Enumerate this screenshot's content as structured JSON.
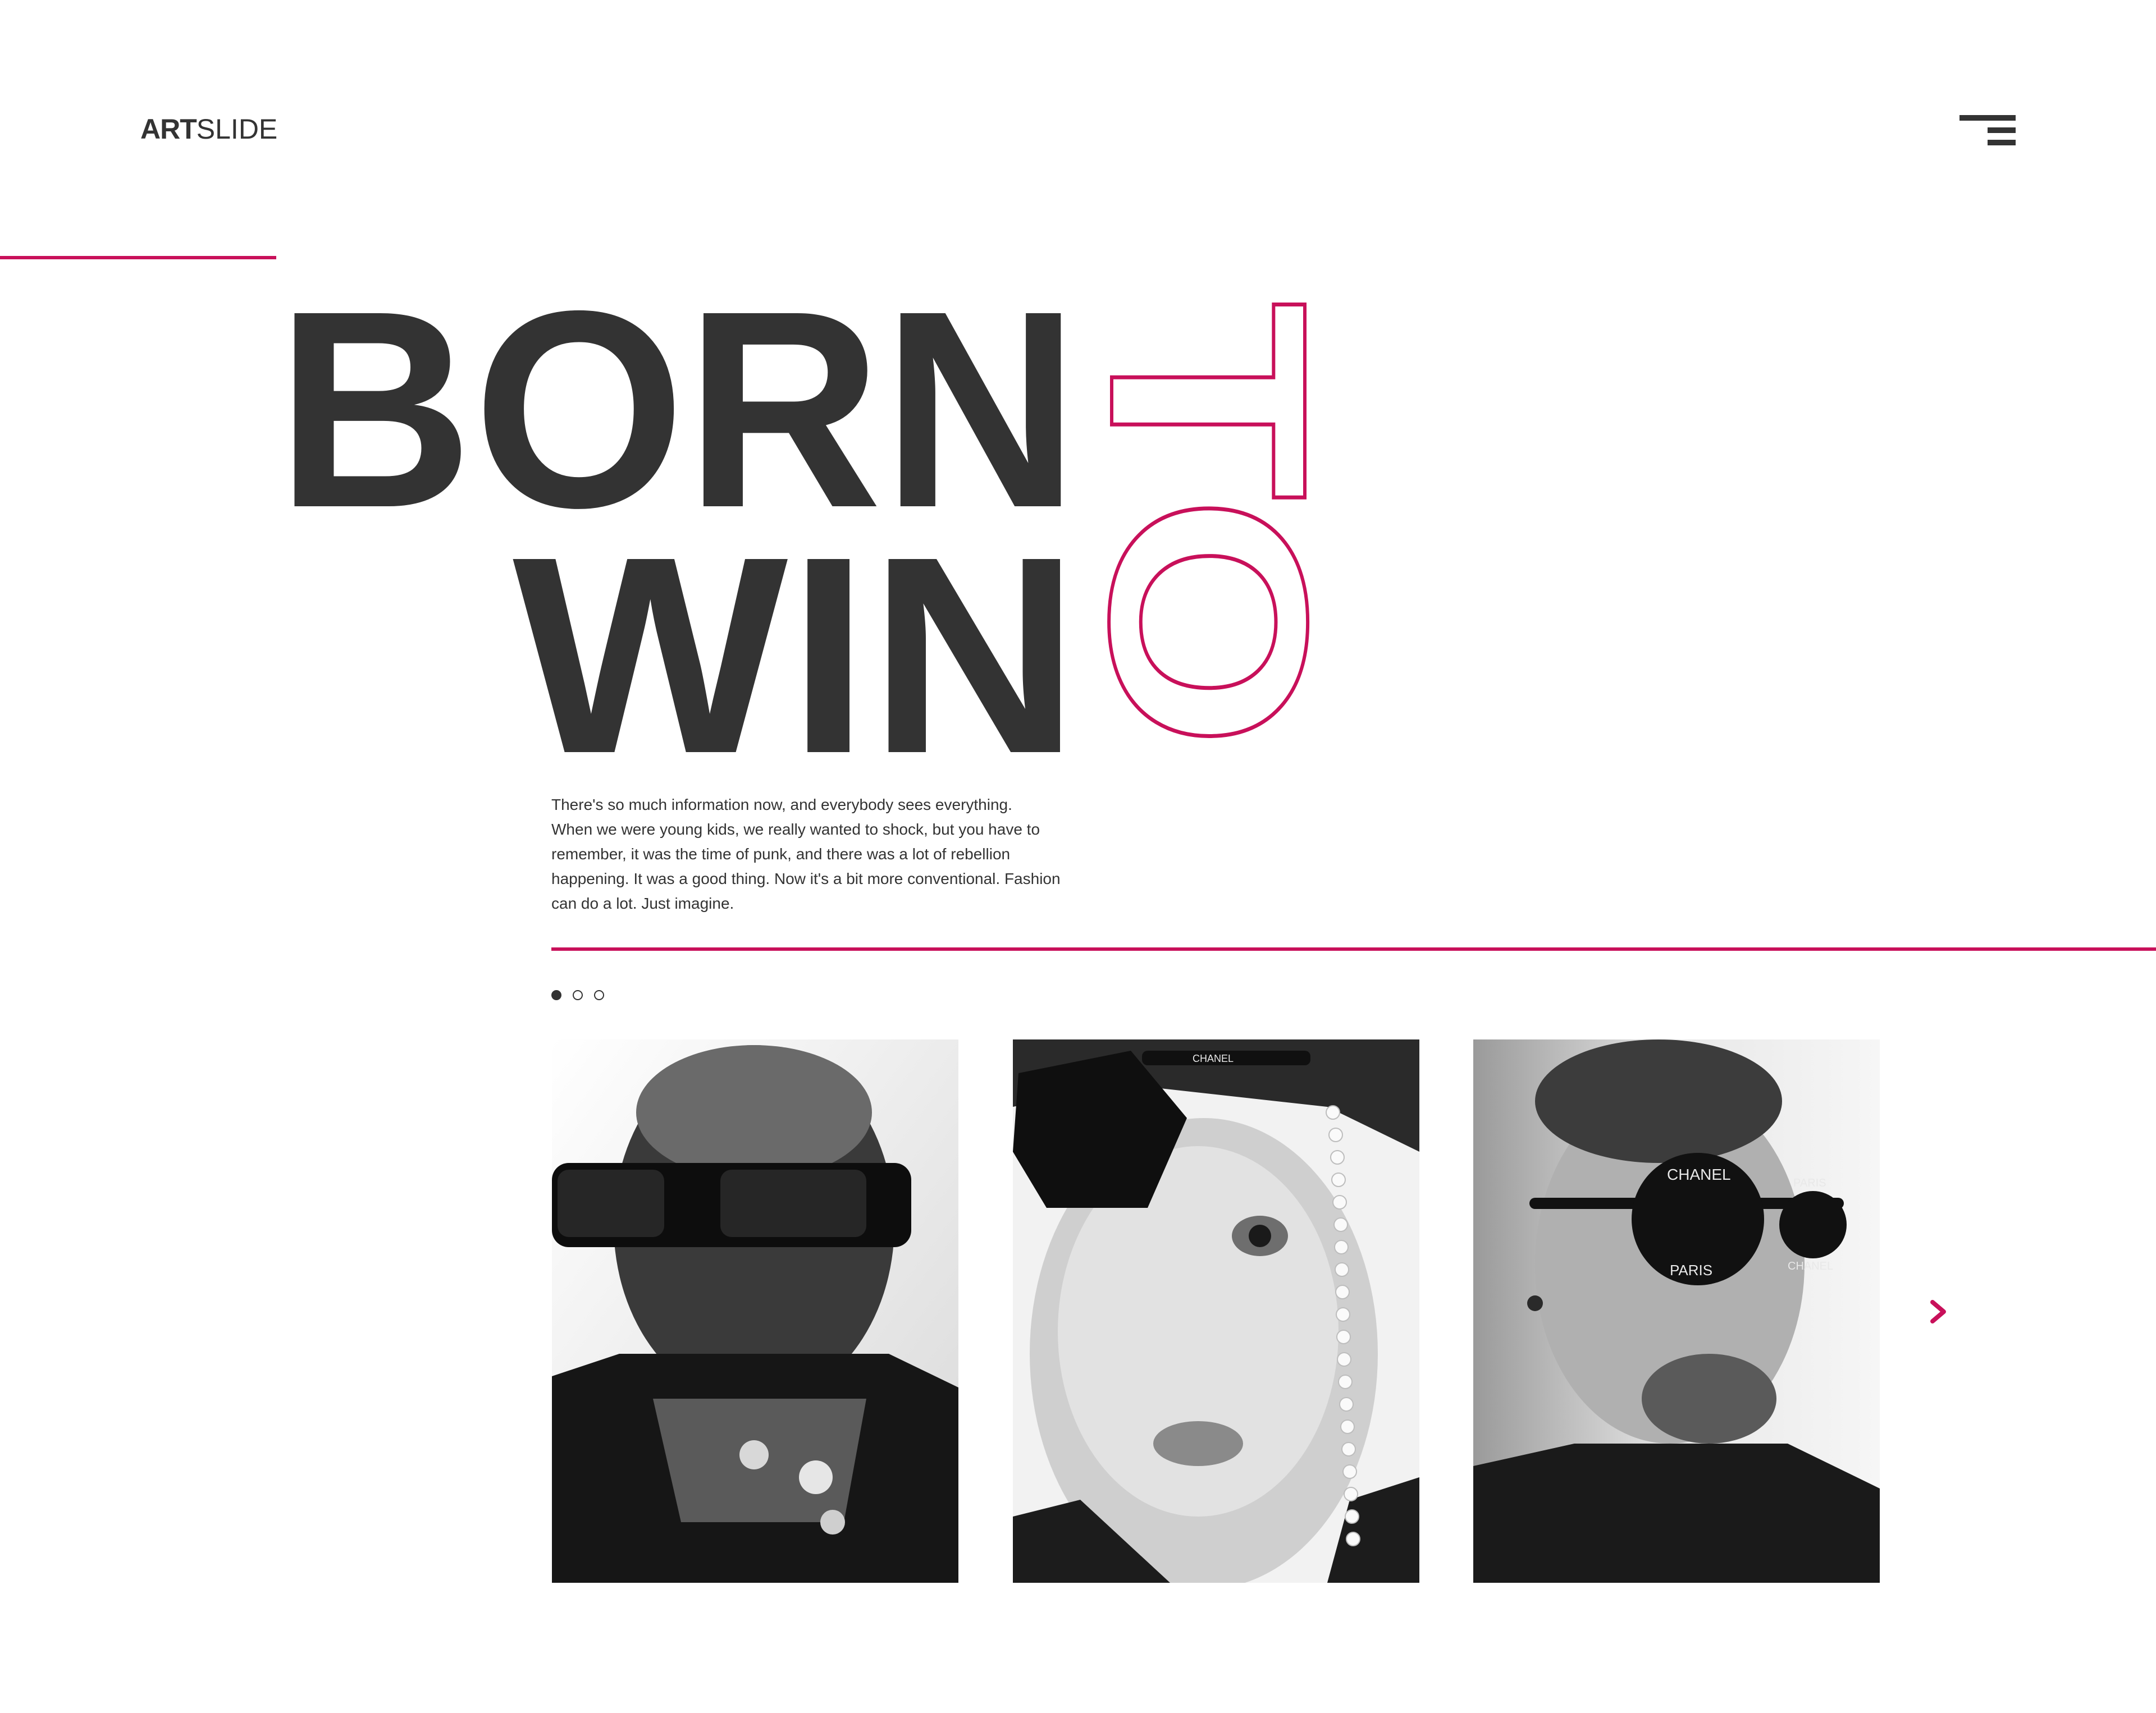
{
  "brand": {
    "strong": "ART",
    "light": "SLIDE"
  },
  "nav": {
    "menu_icon": "hamburger-menu-icon"
  },
  "hero": {
    "line1": "BORN",
    "line2": "WIN",
    "outline_word": "TO"
  },
  "intro": {
    "lines": [
      "There's so much information now, and everybody sees everything.",
      "When we were young kids, we really wanted to shock, but you have to",
      "remember, it was the time of punk, and there was a lot of rebellion",
      "happening. It was a good thing. Now it's a bit more conventional. Fashion",
      "can do a lot. Just imagine."
    ]
  },
  "slider": {
    "dots": 3,
    "active_index": 0,
    "next_icon": "chevron-right-icon",
    "cards": [
      {
        "photo": "man-square-sunglasses-photo",
        "sunglasses_text": []
      },
      {
        "photo": "woman-eyepatch-pearls-photo",
        "sunglasses_text": [
          "CHANEL"
        ]
      },
      {
        "photo": "man-round-sunglasses-photo",
        "sunglasses_text": [
          "CHANEL",
          "PARIS",
          "PARIS",
          "CHANEL"
        ]
      }
    ]
  },
  "colors": {
    "accent": "#c8105a",
    "text": "#333333",
    "background": "#ffffff"
  }
}
